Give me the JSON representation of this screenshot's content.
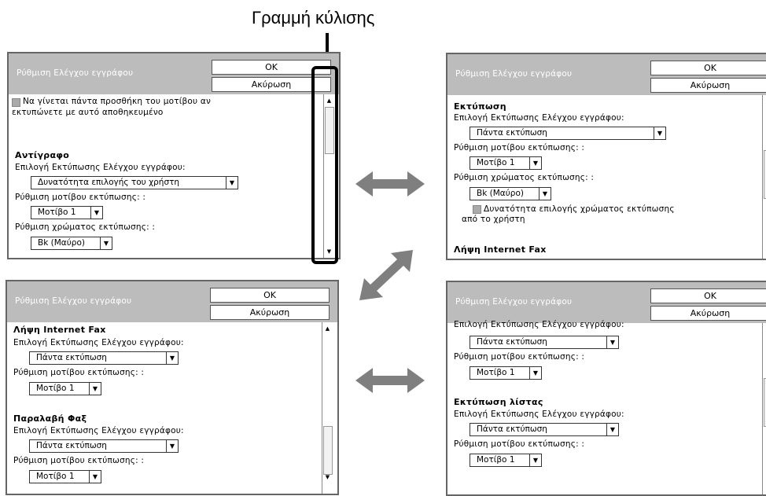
{
  "callout": {
    "label": "Γραμμή κύλισης"
  },
  "panels": {
    "tl": {
      "title": "Ρύθμιση Ελέγχου εγγράφου",
      "ok": "OK",
      "cancel": "Ακύρωση",
      "checkbox_line1": "Να γίνεται πάντα προσθήκη του μοτίβου αν",
      "checkbox_line2": "εκτυπώνετε με αυτό αποθηκευμένο",
      "section": "Αντίγραφο",
      "print_select_label": "Επιλογή Εκτύπωσης Ελέγχου εγγράφου:",
      "print_select_value": "Δυνατότητα επιλογής του χρήστη",
      "pattern_label": "Ρύθμιση μοτίβου εκτύπωσης: :",
      "pattern_value": "Μοτίβο 1",
      "color_label": "Ρύθμιση χρώματος εκτύπωσης: :",
      "color_value": "Bk (Μαύρο)"
    },
    "tr": {
      "title": "Ρύθμιση Ελέγχου εγγράφου",
      "ok": "OK",
      "cancel": "Ακύρωση",
      "section": "Εκτύπωση",
      "print_select_label": "Επιλογή Εκτύπωσης Ελέγχου εγγράφου:",
      "print_select_value": "Πάντα εκτύπωση",
      "pattern_label": "Ρύθμιση μοτίβου εκτύπωσης: :",
      "pattern_value": "Μοτίβο 1",
      "color_label": "Ρύθμιση χρώματος εκτύπωσης: :",
      "color_value": "Bk (Μαύρο)",
      "checkbox_line1": "Δυνατότητα επιλογής χρώματος εκτύπωσης",
      "checkbox_line2": "από το χρήστη",
      "section2": "Λήψη Internet Fax"
    },
    "bl": {
      "title": "Ρύθμιση Ελέγχου εγγράφου",
      "ok": "OK",
      "cancel": "Ακύρωση",
      "section": "Λήψη Internet Fax",
      "print_select_label": "Επιλογή Εκτύπωσης Ελέγχου εγγράφου:",
      "print_select_value": "Πάντα εκτύπωση",
      "pattern_label": "Ρύθμιση μοτίβου εκτύπωσης: :",
      "pattern_value": "Μοτίβο 1",
      "section2": "Παραλαβή Φαξ",
      "print_select_label2": "Επιλογή Εκτύπωσης Ελέγχου εγγράφου:",
      "print_select_value2": "Πάντα εκτύπωση",
      "pattern_label2": "Ρύθμιση μοτίβου εκτύπωσης: :",
      "pattern_value2": "Μοτίβο 1"
    },
    "br": {
      "title": "Ρύθμιση Ελέγχου εγγράφου",
      "ok": "OK",
      "cancel": "Ακύρωση",
      "print_select_label": "Επιλογή Εκτύπωσης Ελέγχου εγγράφου:",
      "print_select_value": "Πάντα εκτύπωση",
      "pattern_label": "Ρύθμιση μοτίβου εκτύπωσης: :",
      "pattern_value": "Μοτίβο 1",
      "section": "Εκτύπωση λίστας",
      "print_select_label2": "Επιλογή Εκτύπωσης Ελέγχου εγγράφου:",
      "print_select_value2": "Πάντα εκτύπωση",
      "pattern_label2": "Ρύθμιση μοτίβου εκτύπωσης: :",
      "pattern_value2": "Μοτίβο 1"
    }
  },
  "icons": {
    "dropdown": "▼",
    "scroll_up": "▲",
    "scroll_down": "▼"
  },
  "colors": {
    "header": "#bcbcbc",
    "arrow": "#7f7f7f"
  }
}
